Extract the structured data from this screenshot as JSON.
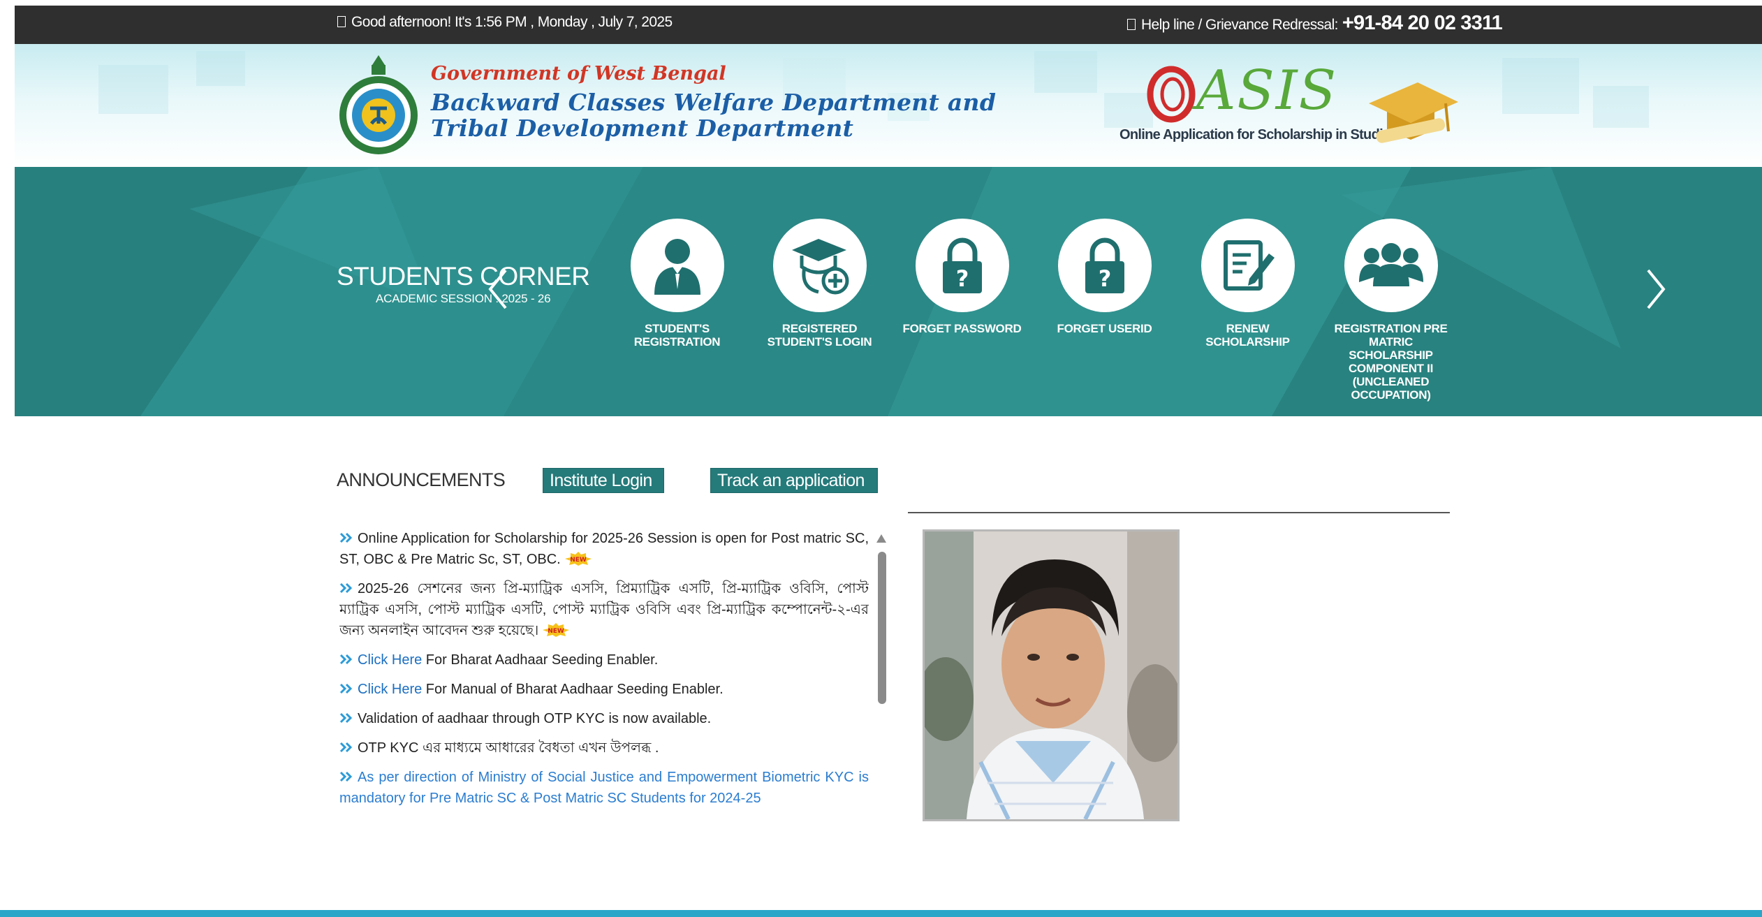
{
  "topbar": {
    "greeting": "Good afternoon! It's 1:56 PM , Monday , July 7, 2025",
    "helpline_label": "Help line / Grievance Redressal:",
    "helpline_number": "+91-84 20 02 3311"
  },
  "header": {
    "gov_title": "Government of West Bengal",
    "dept_line1": "Backward Classes Welfare Department and",
    "dept_line2": "Tribal Development Department",
    "oasis_logo": "ASIS",
    "oasis_tagline": "Online Application for Scholarship in Studies"
  },
  "students_corner": {
    "title": "STUDENTS CORNER",
    "session": "ACADEMIC SESSION : 2025 - 26",
    "tiles": [
      {
        "label": "STUDENT'S REGISTRATION",
        "icon": "student-icon"
      },
      {
        "label": "REGISTERED STUDENT'S LOGIN",
        "icon": "graduate-add-icon"
      },
      {
        "label": "FORGET PASSWORD",
        "icon": "lock-question-icon"
      },
      {
        "label": "FORGET USERID",
        "icon": "lock-question-icon"
      },
      {
        "label": "RENEW SCHOLARSHIP",
        "icon": "edit-document-icon"
      },
      {
        "label": "REGISTRATION PRE MATRIC SCHOLARSHIP COMPONENT II (UNCLEANED OCCUPATION)",
        "icon": "group-icon"
      }
    ]
  },
  "announcements": {
    "heading": "ANNOUNCEMENTS",
    "institute_login": "Institute Login",
    "track_application": "Track an application",
    "new_badge": "NEW",
    "items": [
      {
        "text": "Online Application for Scholarship for 2025-26 Session is open for Post matric SC, ST, OBC & Pre Matric Sc, ST, OBC."
      },
      {
        "text": "2025-26 সেশনের জন্য প্রি-ম্যাট্রিক এসসি, প্রিম্যাট্রিক এসটি, প্রি-ম্যাট্রিক ওবিসি, পোস্ট ম্যাট্রিক এসসি, পোস্ট ম্যাট্রিক এসটি, পোস্ট ম্যাট্রিক ওবিসি এবং প্রি-ম্যাট্রিক কম্পোনেন্ট-২-এর জন্য অনলাইন আবেদন শুরু হয়েছে।"
      },
      {
        "link": "Click Here",
        "text": " For Bharat Aadhaar Seeding Enabler."
      },
      {
        "link": "Click Here",
        "text": " For Manual of Bharat Aadhaar Seeding Enabler."
      },
      {
        "text": "Validation of aadhaar through OTP KYC is now available."
      },
      {
        "text": "OTP KYC এর মাধ্যমে আধারের বৈধতা এখন উপলব্ধ ."
      },
      {
        "text": "As per direction of Ministry of Social Justice and Empowerment Biometric KYC is mandatory for Pre Matric SC & Post Matric SC Students for 2024-25"
      }
    ]
  },
  "colors": {
    "teal": "#2b8b89",
    "button": "#257a7a",
    "link": "#1b6fc2",
    "topbar": "#2f2f2f"
  }
}
